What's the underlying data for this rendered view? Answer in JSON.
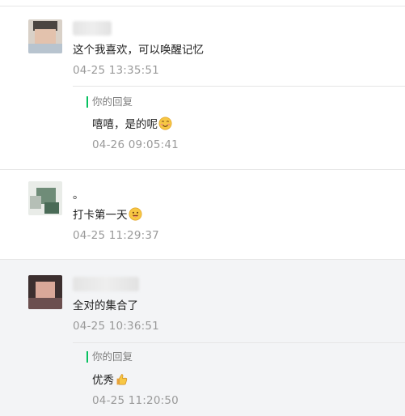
{
  "comments": [
    {
      "text": "这个我喜欢，可以唤醒记忆",
      "time": "04-25 13:35:51",
      "avatar_icon": "blurred-profile-photo",
      "reply": {
        "label": "你的回复",
        "text": "嘻嘻，是的呢",
        "emoji_icon": "smiling-face-emoji",
        "time": "04-26 09:05:41"
      }
    },
    {
      "title": "。",
      "text": "打卡第一天",
      "emoji_icon": "grinning-face-emoji",
      "time": "04-25 11:29:37",
      "avatar_icon": "blurred-profile-photo"
    },
    {
      "text": "全对的集合了",
      "time": "04-25 10:36:51",
      "avatar_icon": "blurred-profile-photo",
      "reply": {
        "label": "你的回复",
        "text": "优秀",
        "emoji_icon": "thumbs-up-emoji",
        "time": "04-25 11:20:50"
      }
    }
  ],
  "colors": {
    "reply_bar": "#07c160",
    "time": "#9a9a9a",
    "highlight_bg": "#f3f4f6",
    "divider": "#e6e6e6"
  }
}
